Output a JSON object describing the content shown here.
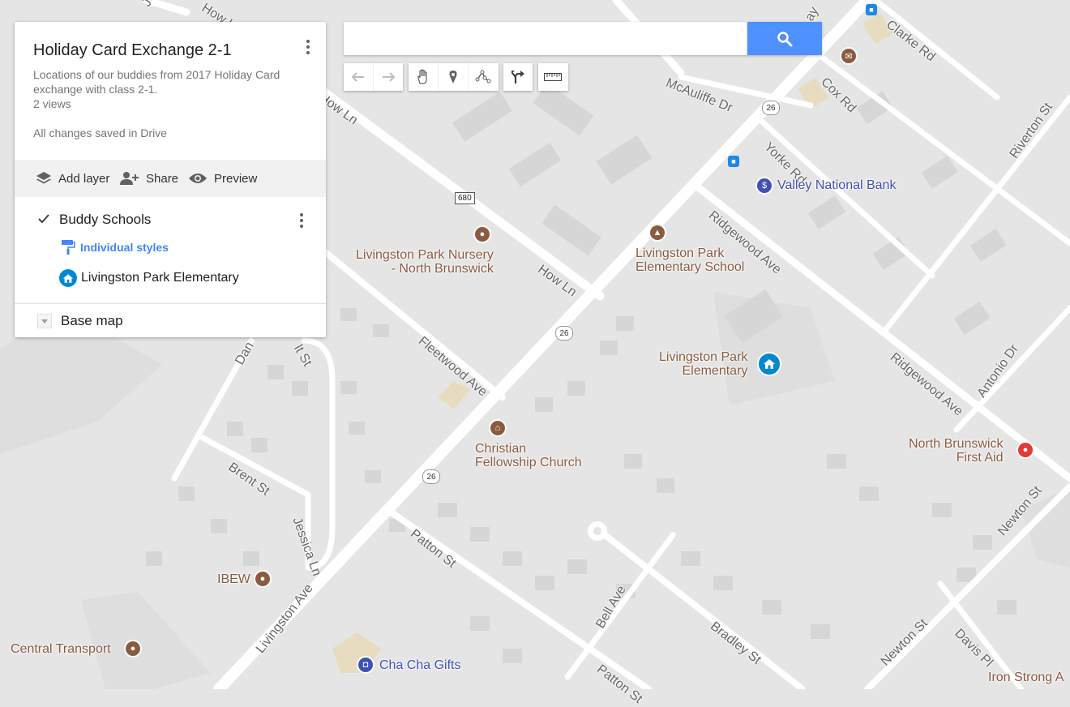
{
  "panel": {
    "title": "Holiday Card Exchange 2-1",
    "description": "Locations of our buddies from 2017 Holiday Card exchange with class 2-1.",
    "views": "2 views",
    "saved_status": "All changes saved in Drive",
    "actions": {
      "add_layer": "Add layer",
      "share": "Share",
      "preview": "Preview"
    },
    "layer": {
      "name": "Buddy Schools",
      "checked": true,
      "style_link": "Individual styles",
      "places": [
        "Livingston Park Elementary"
      ]
    },
    "base_map": "Base map"
  },
  "search": {
    "value": "",
    "placeholder": ""
  },
  "toolbar": {
    "history": [
      "undo-icon",
      "redo-icon"
    ],
    "tools": [
      "hand-icon",
      "marker-icon",
      "draw-line-icon"
    ],
    "directions": "directions-icon",
    "measure": "ruler-icon"
  },
  "map": {
    "streets": {
      "jersey_ave": "Jersey Ave",
      "how_ln_top": "How Ln",
      "how_ln": "How Ln",
      "mcauliffe": "McAuliffe Dr",
      "cox": "Cox Rd",
      "clarke": "Clarke Rd",
      "yorke": "Yorke Rd",
      "riverton": "Riverton St",
      "ridgewood_1": "Ridgewood Ave",
      "ridgewood_2": "Ridgewood Ave",
      "antonio": "Antonio Dr",
      "fleetwood": "Fleetwood Ave",
      "dan": "Dan",
      "st_partial": "lt St",
      "brent": "Brent St",
      "jessica": "Jessica Ln",
      "patton_1": "Patton St",
      "patton_2": "Patton St",
      "livingston": "Livingston Ave",
      "bell": "Bell Ave",
      "bradley": "Bradley St",
      "newton_1": "Newton St",
      "newton_2": "Newton St",
      "davis": "Davis Pl",
      "parkway_partial": "ay"
    },
    "shields": {
      "route_26_a": "26",
      "route_26_b": "26",
      "route_26_c": "26",
      "route_680": "680"
    },
    "pois": {
      "nursery": "Livingston Park Nursery\n- North Brunswick",
      "school": "Livingston Park\nElementary School",
      "church": "Christian\nFellowship Church",
      "bank": "Valley National Bank",
      "elementary": "Livingston Park\nElementary",
      "first_aid": "North Brunswick\nFirst Aid",
      "ibew": "IBEW",
      "central_transport": "Central Transport",
      "cha_cha": "Cha Cha Gifts",
      "iron_strong": "Iron Strong A"
    }
  },
  "colors": {
    "map_bg": "#e5e5e5",
    "road": "#ffffff",
    "building": "#d4d4d4",
    "accent": "#4d90fe",
    "poi_brown": "#8a5b3f",
    "school_blue": "#0288d1",
    "first_aid_red": "#e53935"
  }
}
